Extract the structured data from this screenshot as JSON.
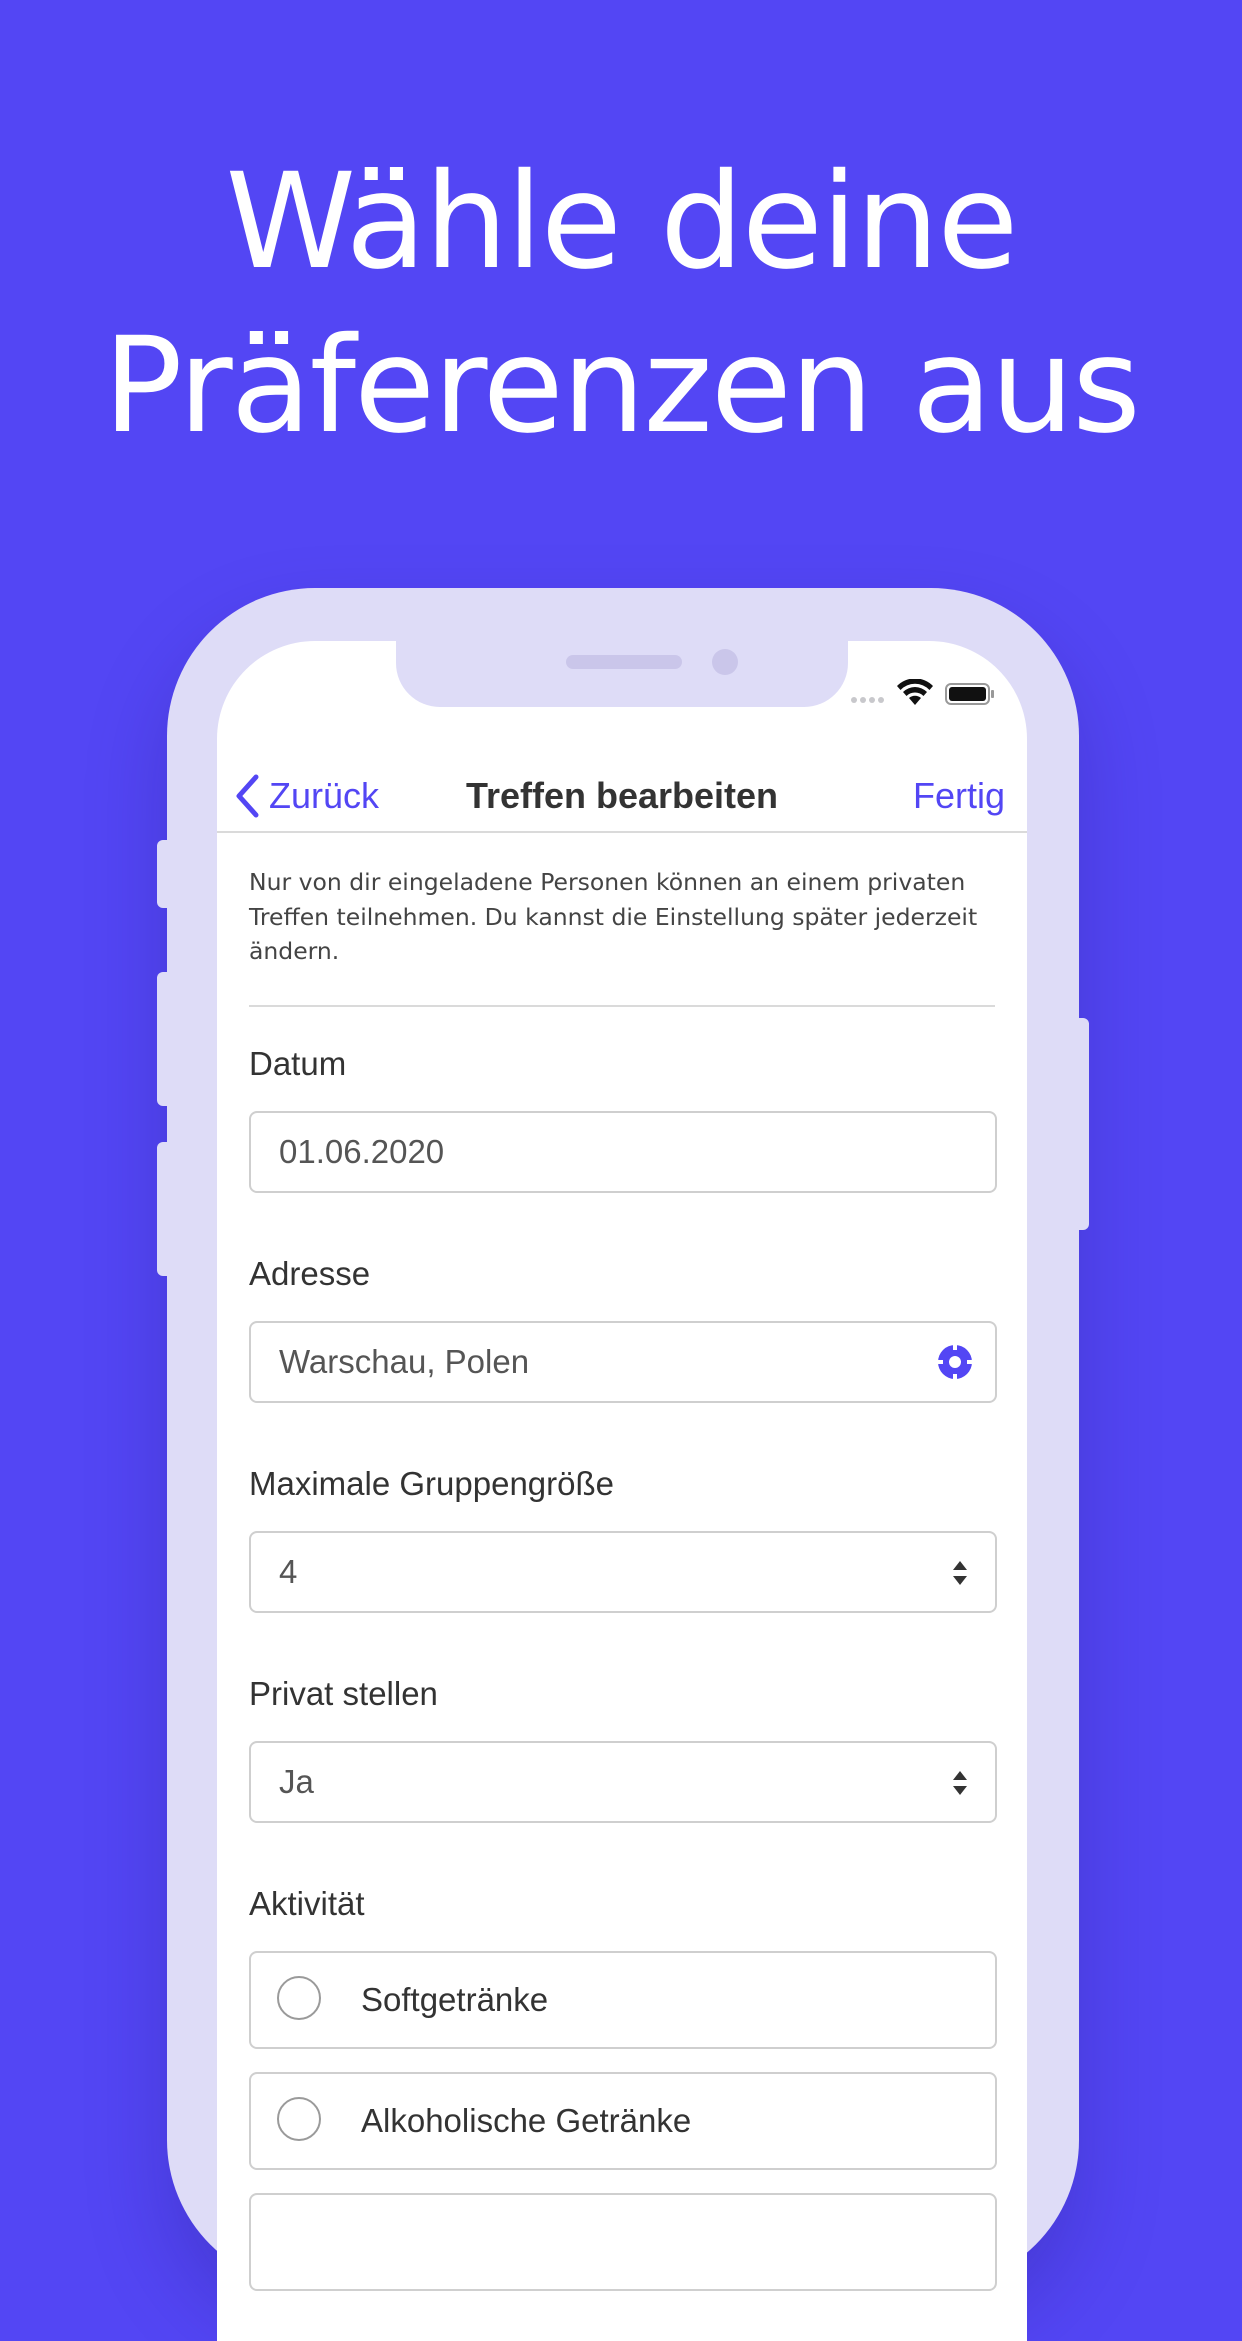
{
  "headline": {
    "line1": "Wähle deine",
    "line2": "Präferenzen aus"
  },
  "status_bar": {
    "wifi_icon": "wifi-icon",
    "battery_icon": "battery-icon"
  },
  "nav": {
    "back_label": "Zurück",
    "title": "Treffen bearbeiten",
    "done_label": "Fertig"
  },
  "info": {
    "text": "Nur von dir eingeladene Personen können an einem privaten Treffen teilnehmen. Du kannst die Einstellung später jederzeit ändern."
  },
  "form": {
    "date": {
      "label": "Datum",
      "value": "01.06.2020"
    },
    "address": {
      "label": "Adresse",
      "value": "Warschau, Polen",
      "icon": "location-target-icon"
    },
    "group_size": {
      "label": "Maximale Gruppengröße",
      "value": "4"
    },
    "private": {
      "label": "Privat stellen",
      "value": "Ja"
    },
    "activity": {
      "label": "Aktivität",
      "options": [
        {
          "label": "Softgetränke",
          "selected": false
        },
        {
          "label": "Alkoholische Getränke",
          "selected": false
        }
      ]
    }
  },
  "colors": {
    "brand": "#5346F4",
    "phone_frame": "#DEDCF7"
  }
}
